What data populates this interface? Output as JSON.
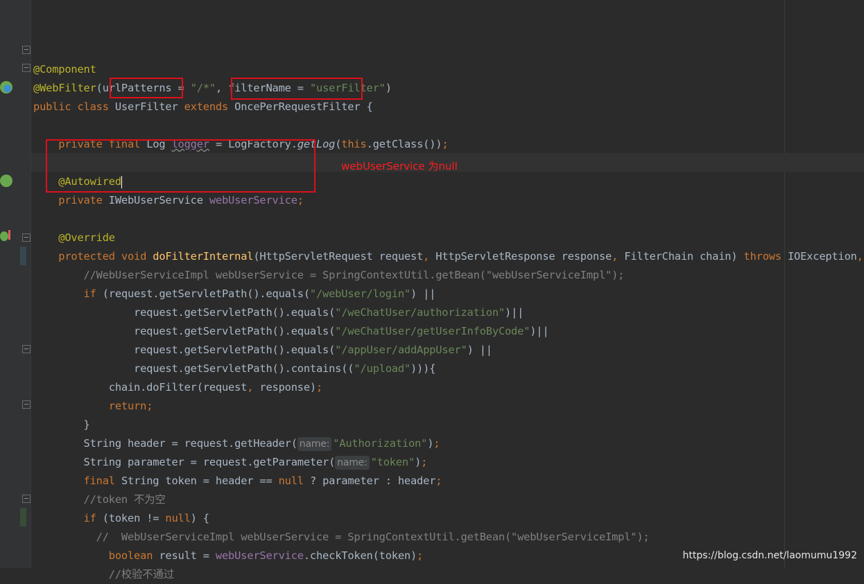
{
  "editor": {
    "lines": [
      "",
      "@Component",
      "@WebFilter(urlPatterns = \"/*\", filterName = \"userFilter\")",
      "public class UserFilter extends OncePerRequestFilter {",
      "",
      "private final Log logger = LogFactory.getLog(this.getClass());",
      "",
      "@Autowired",
      "private IWebUserService webUserService;",
      "",
      "@Override",
      "protected void doFilterInternal(HttpServletRequest request, HttpServletResponse response, FilterChain chain) throws IOException,",
      "//WebUserServiceImpl webUserService = SpringContextUtil.getBean(\"webUserServiceImpl\");",
      "if (request.getServletPath().equals(\"/webUser/login\") ||",
      "request.getServletPath().equals(\"/weChatUser/authorization\")||",
      "request.getServletPath().equals(\"/weChatUser/getUserInfoByCode\")||",
      "request.getServletPath().equals(\"/appUser/addAppUser\") ||",
      "request.getServletPath().contains((\"/upload\"))){",
      "chain.doFilter(request, response);",
      "return;",
      "}",
      "String header = request.getHeader( name: \"Authorization\");",
      "String parameter = request.getParameter( name: \"token\");",
      "final String token = header == null ? parameter : header;",
      "//token 不为空",
      "if (token != null) {",
      "//  WebUserServiceImpl webUserService = SpringContextUtil.getBean(\"webUserServiceImpl\");",
      "boolean result = webUserService.checkToken(token);",
      "//校验不通过"
    ],
    "param_hint": "name:"
  },
  "annotation": {
    "note": "webUserService 为null"
  },
  "watermark": "https://blog.csdn.net/laomumu1992",
  "colors": {
    "background": "#2b2b2b",
    "keyword": "#cc7832",
    "annotation": "#bbb529",
    "string": "#6a8759",
    "method": "#ffc66d",
    "field": "#9876aa",
    "comment": "#808080",
    "highlight_box": "#e0101a"
  },
  "icons": [
    "spring-bean-icon",
    "autowired-navigate-icon",
    "override-method-icon",
    "fold-icon"
  ]
}
